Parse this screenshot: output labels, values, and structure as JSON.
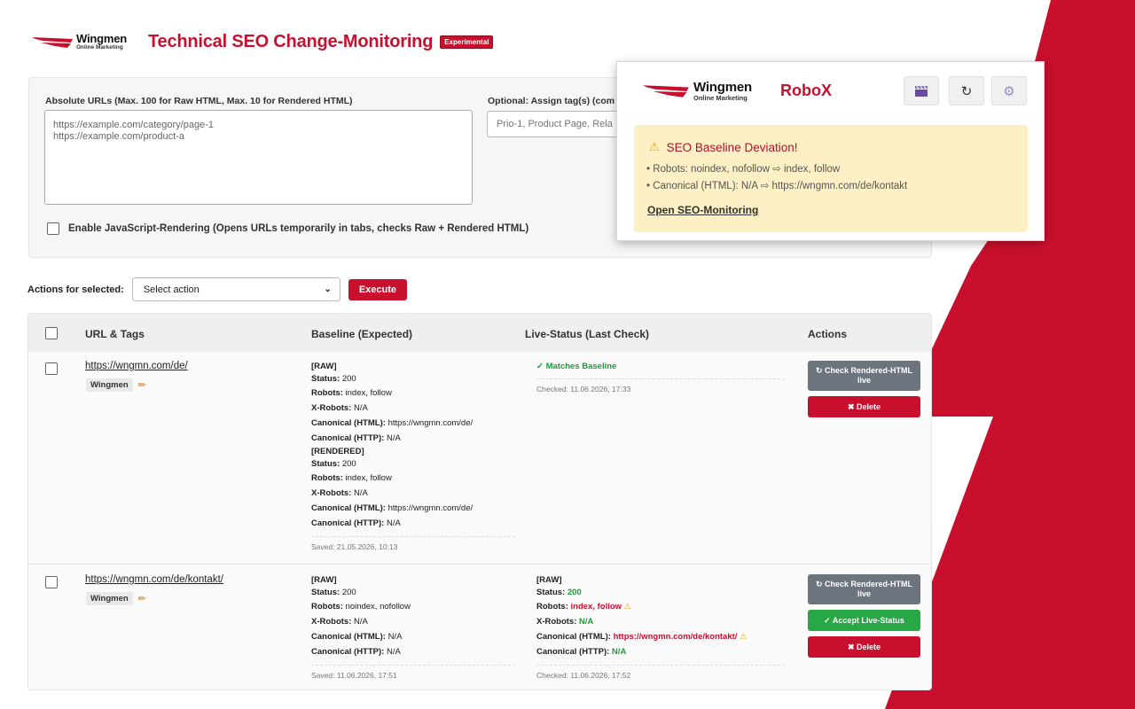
{
  "brand": {
    "logo_main": "Wingmen",
    "logo_sub": "Online Marketing",
    "accent_color": "#c8102e"
  },
  "header": {
    "title": "Technical SEO Change-Monitoring",
    "badge": "Experimental"
  },
  "form": {
    "urls_label": "Absolute URLs (Max. 100 for Raw HTML, Max. 10 for Rendered HTML)",
    "urls_placeholder": "https://example.com/category/page-1\nhttps://example.com/product-a",
    "tags_label": "Optional: Assign tag(s) (com",
    "tags_placeholder": "Prio-1, Product Page, Rela",
    "js_rendering_label": "Enable JavaScript-Rendering (Opens URLs temporarily in tabs, checks Raw + Rendered HTML)"
  },
  "actions_bar": {
    "label": "Actions for selected:",
    "select_value": "Select action",
    "execute_label": "Execute"
  },
  "table": {
    "headers": [
      "URL & Tags",
      "Baseline (Expected)",
      "Live-Status (Last Check)",
      "Actions"
    ],
    "rows": [
      {
        "url": "https://wngmn.com/de/",
        "tag": "Wingmen",
        "baseline": {
          "raw_header": "[RAW]",
          "status_label": "Status:",
          "status": "200",
          "robots_label": "Robots:",
          "robots": "index, follow",
          "xrobots_label": "X-Robots:",
          "xrobots": "N/A",
          "canon_html_label": "Canonical (HTML):",
          "canon_html": "https://wngmn.com/de/",
          "canon_http_label": "Canonical (HTTP):",
          "canon_http": "N/A",
          "rendered_header": "[RENDERED]",
          "r_status": "200",
          "r_robots": "index, follow",
          "r_xrobots": "N/A",
          "r_canon_html": "https://wngmn.com/de/",
          "r_canon_http": "N/A",
          "saved": "Saved: 21.05.2026, 10:13"
        },
        "live": {
          "status_text": "✓ Matches Baseline",
          "checked": "Checked: 11.06.2026, 17:33"
        },
        "actions": {
          "check_rendered": "↻ Check Rendered-HTML live",
          "delete": "✖ Delete"
        }
      },
      {
        "url": "https://wngmn.com/de/kontakt/",
        "tag": "Wingmen",
        "baseline": {
          "raw_header": "[RAW]",
          "status": "200",
          "robots": "noindex, nofollow",
          "xrobots": "N/A",
          "canon_html": "N/A",
          "canon_http": "N/A",
          "saved": "Saved: 11.06.2026, 17:51"
        },
        "live": {
          "raw_header": "[RAW]",
          "status": "200",
          "robots": "index, follow",
          "xrobots": "N/A",
          "canon_html": "https://wngmn.com/de/kontakt/",
          "canon_http": "N/A",
          "checked": "Checked: 11.06.2026, 17:52"
        },
        "actions": {
          "check_rendered": "↻ Check Rendered-HTML live",
          "accept": "✓ Accept Live-Status",
          "delete": "✖ Delete"
        }
      }
    ]
  },
  "popup": {
    "title": "RoboX",
    "icons": [
      "clapper-icon",
      "refresh-icon",
      "gear-icon"
    ],
    "alert_title": "SEO Baseline Deviation!",
    "alert_lines": [
      "• Robots: noindex, nofollow ⇨ index, follow",
      "• Canonical (HTML): N/A ⇨ https://wngmn.com/de/kontakt"
    ],
    "alert_link": "Open SEO-Monitoring"
  }
}
